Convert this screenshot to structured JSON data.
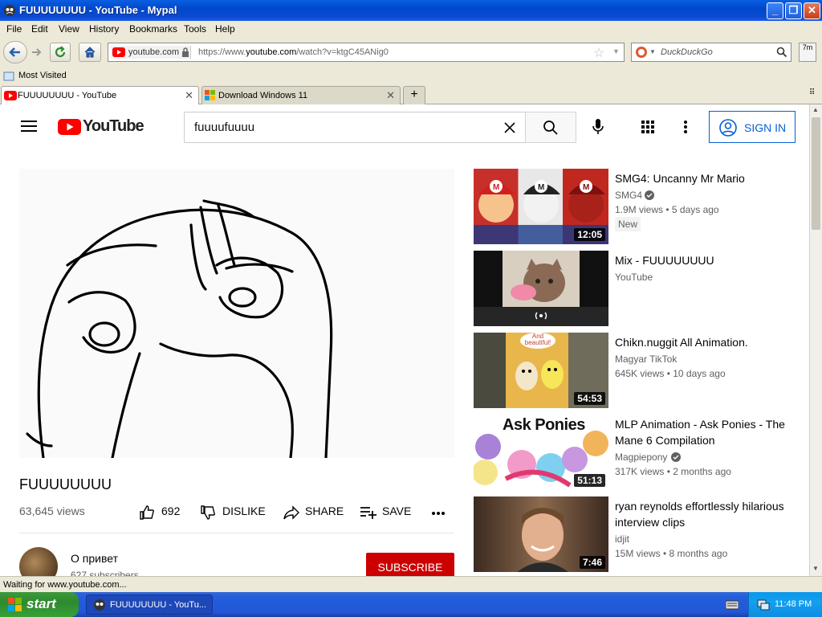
{
  "window": {
    "title": "FUUUUUUUU - YouTube - Mypal"
  },
  "menu": [
    "File",
    "Edit",
    "View",
    "History",
    "Bookmarks",
    "Tools",
    "Help"
  ],
  "nav": {
    "site_label": "youtube.com",
    "url_prefix": "https://www.",
    "url_domain": "youtube.com",
    "url_rest": "/watch?v=ktgC45ANig0",
    "search_placeholder": "DuckDuckGo"
  },
  "bookmarks": {
    "most_visited": "Most Visited"
  },
  "tabs": [
    {
      "label": "FUUUUUUUU - YouTube",
      "active": true
    },
    {
      "label": "Download Windows 11",
      "active": false
    }
  ],
  "youtube": {
    "logo_text": "YouTube",
    "search_value": "fuuuufuuuu",
    "signin_label": "SIGN IN",
    "video_title": "FUUUUUUUU",
    "views": "63,645 views",
    "likes": "692",
    "dislike_label": "DISLIKE",
    "share_label": "SHARE",
    "save_label": "SAVE",
    "channel_name": "О привет",
    "subscribers": "627 subscribers",
    "subscribe_label": "SUBSCRIBE",
    "recommendations": [
      {
        "title": "SMG4: Uncanny Mr Mario",
        "channel": "SMG4",
        "verified": true,
        "meta": "1.9M views • 5 days ago",
        "badge": "New",
        "duration": "12:05",
        "thumb_color": "#c7302a"
      },
      {
        "title": "Mix - FUUUUUUUU",
        "channel": "YouTube",
        "verified": false,
        "meta": "",
        "badge": "",
        "duration": "",
        "thumb_color": "#8a6a55"
      },
      {
        "title": "Chikn.nuggit All Animation.",
        "channel": "Magyar TikTok",
        "verified": false,
        "meta": "645K views • 10 days ago",
        "badge": "",
        "duration": "54:53",
        "thumb_color": "#e5b845"
      },
      {
        "title": "MLP Animation - Ask Ponies - The Mane 6 Compilation",
        "channel": "Magpiepony",
        "verified": true,
        "meta": "317K views • 2 months ago",
        "badge": "",
        "duration": "51:13",
        "thumb_color": "#e49ac8"
      },
      {
        "title": "ryan reynolds effortlessly hilarious interview clips",
        "channel": "idjit",
        "verified": false,
        "meta": "15M views • 8 months ago",
        "badge": "",
        "duration": "7:46",
        "thumb_color": "#7a5a3e"
      }
    ],
    "thumb_text_1": "And beautiful!",
    "thumb_text_2": "Ask Ponies"
  },
  "status": {
    "text": "Waiting for www.youtube.com..."
  },
  "taskbar": {
    "start_label": "start",
    "task_label": "FUUUUUUUU - YouTu...",
    "clock": "11:48 PM"
  },
  "colors": {
    "yt_red": "#ff0000",
    "subscribe_red": "#cc0000",
    "link_blue": "#065fd4"
  }
}
